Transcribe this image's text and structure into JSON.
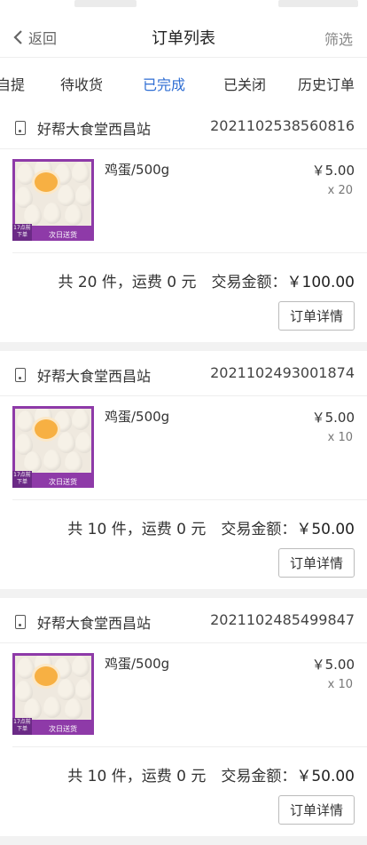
{
  "nav": {
    "back_label": "返回",
    "title": "订单列表",
    "filter_label": "筛选"
  },
  "tabs": [
    {
      "label": "自提",
      "active": false
    },
    {
      "label": "待收货",
      "active": false
    },
    {
      "label": "已完成",
      "active": true
    },
    {
      "label": "已关闭",
      "active": false
    },
    {
      "label": "历史订单",
      "active": false
    }
  ],
  "colors": {
    "accent": "#2f6ed3",
    "product_frame": "#8e3aa8"
  },
  "orders": [
    {
      "store": "好帮大食堂西昌站",
      "order_no": "2021102538560816",
      "product": {
        "name": "鸡蛋/500g",
        "price": "￥5.00",
        "qty": "x 20",
        "badge": "17点前下单",
        "strip": "次日送货"
      },
      "summary": "共 20 件，运费 0 元　交易金额：",
      "amount": "￥100.00",
      "detail_label": "订单详情"
    },
    {
      "store": "好帮大食堂西昌站",
      "order_no": "2021102493001874",
      "product": {
        "name": "鸡蛋/500g",
        "price": "￥5.00",
        "qty": "x 10",
        "badge": "17点前下单",
        "strip": "次日送货"
      },
      "summary": "共 10 件，运费 0 元　交易金额：",
      "amount": "￥50.00",
      "detail_label": "订单详情"
    },
    {
      "store": "好帮大食堂西昌站",
      "order_no": "2021102485499847",
      "product": {
        "name": "鸡蛋/500g",
        "price": "￥5.00",
        "qty": "x 10",
        "badge": "17点前下单",
        "strip": "次日送货"
      },
      "summary": "共 10 件，运费 0 元　交易金额：",
      "amount": "￥50.00",
      "detail_label": "订单详情"
    }
  ]
}
